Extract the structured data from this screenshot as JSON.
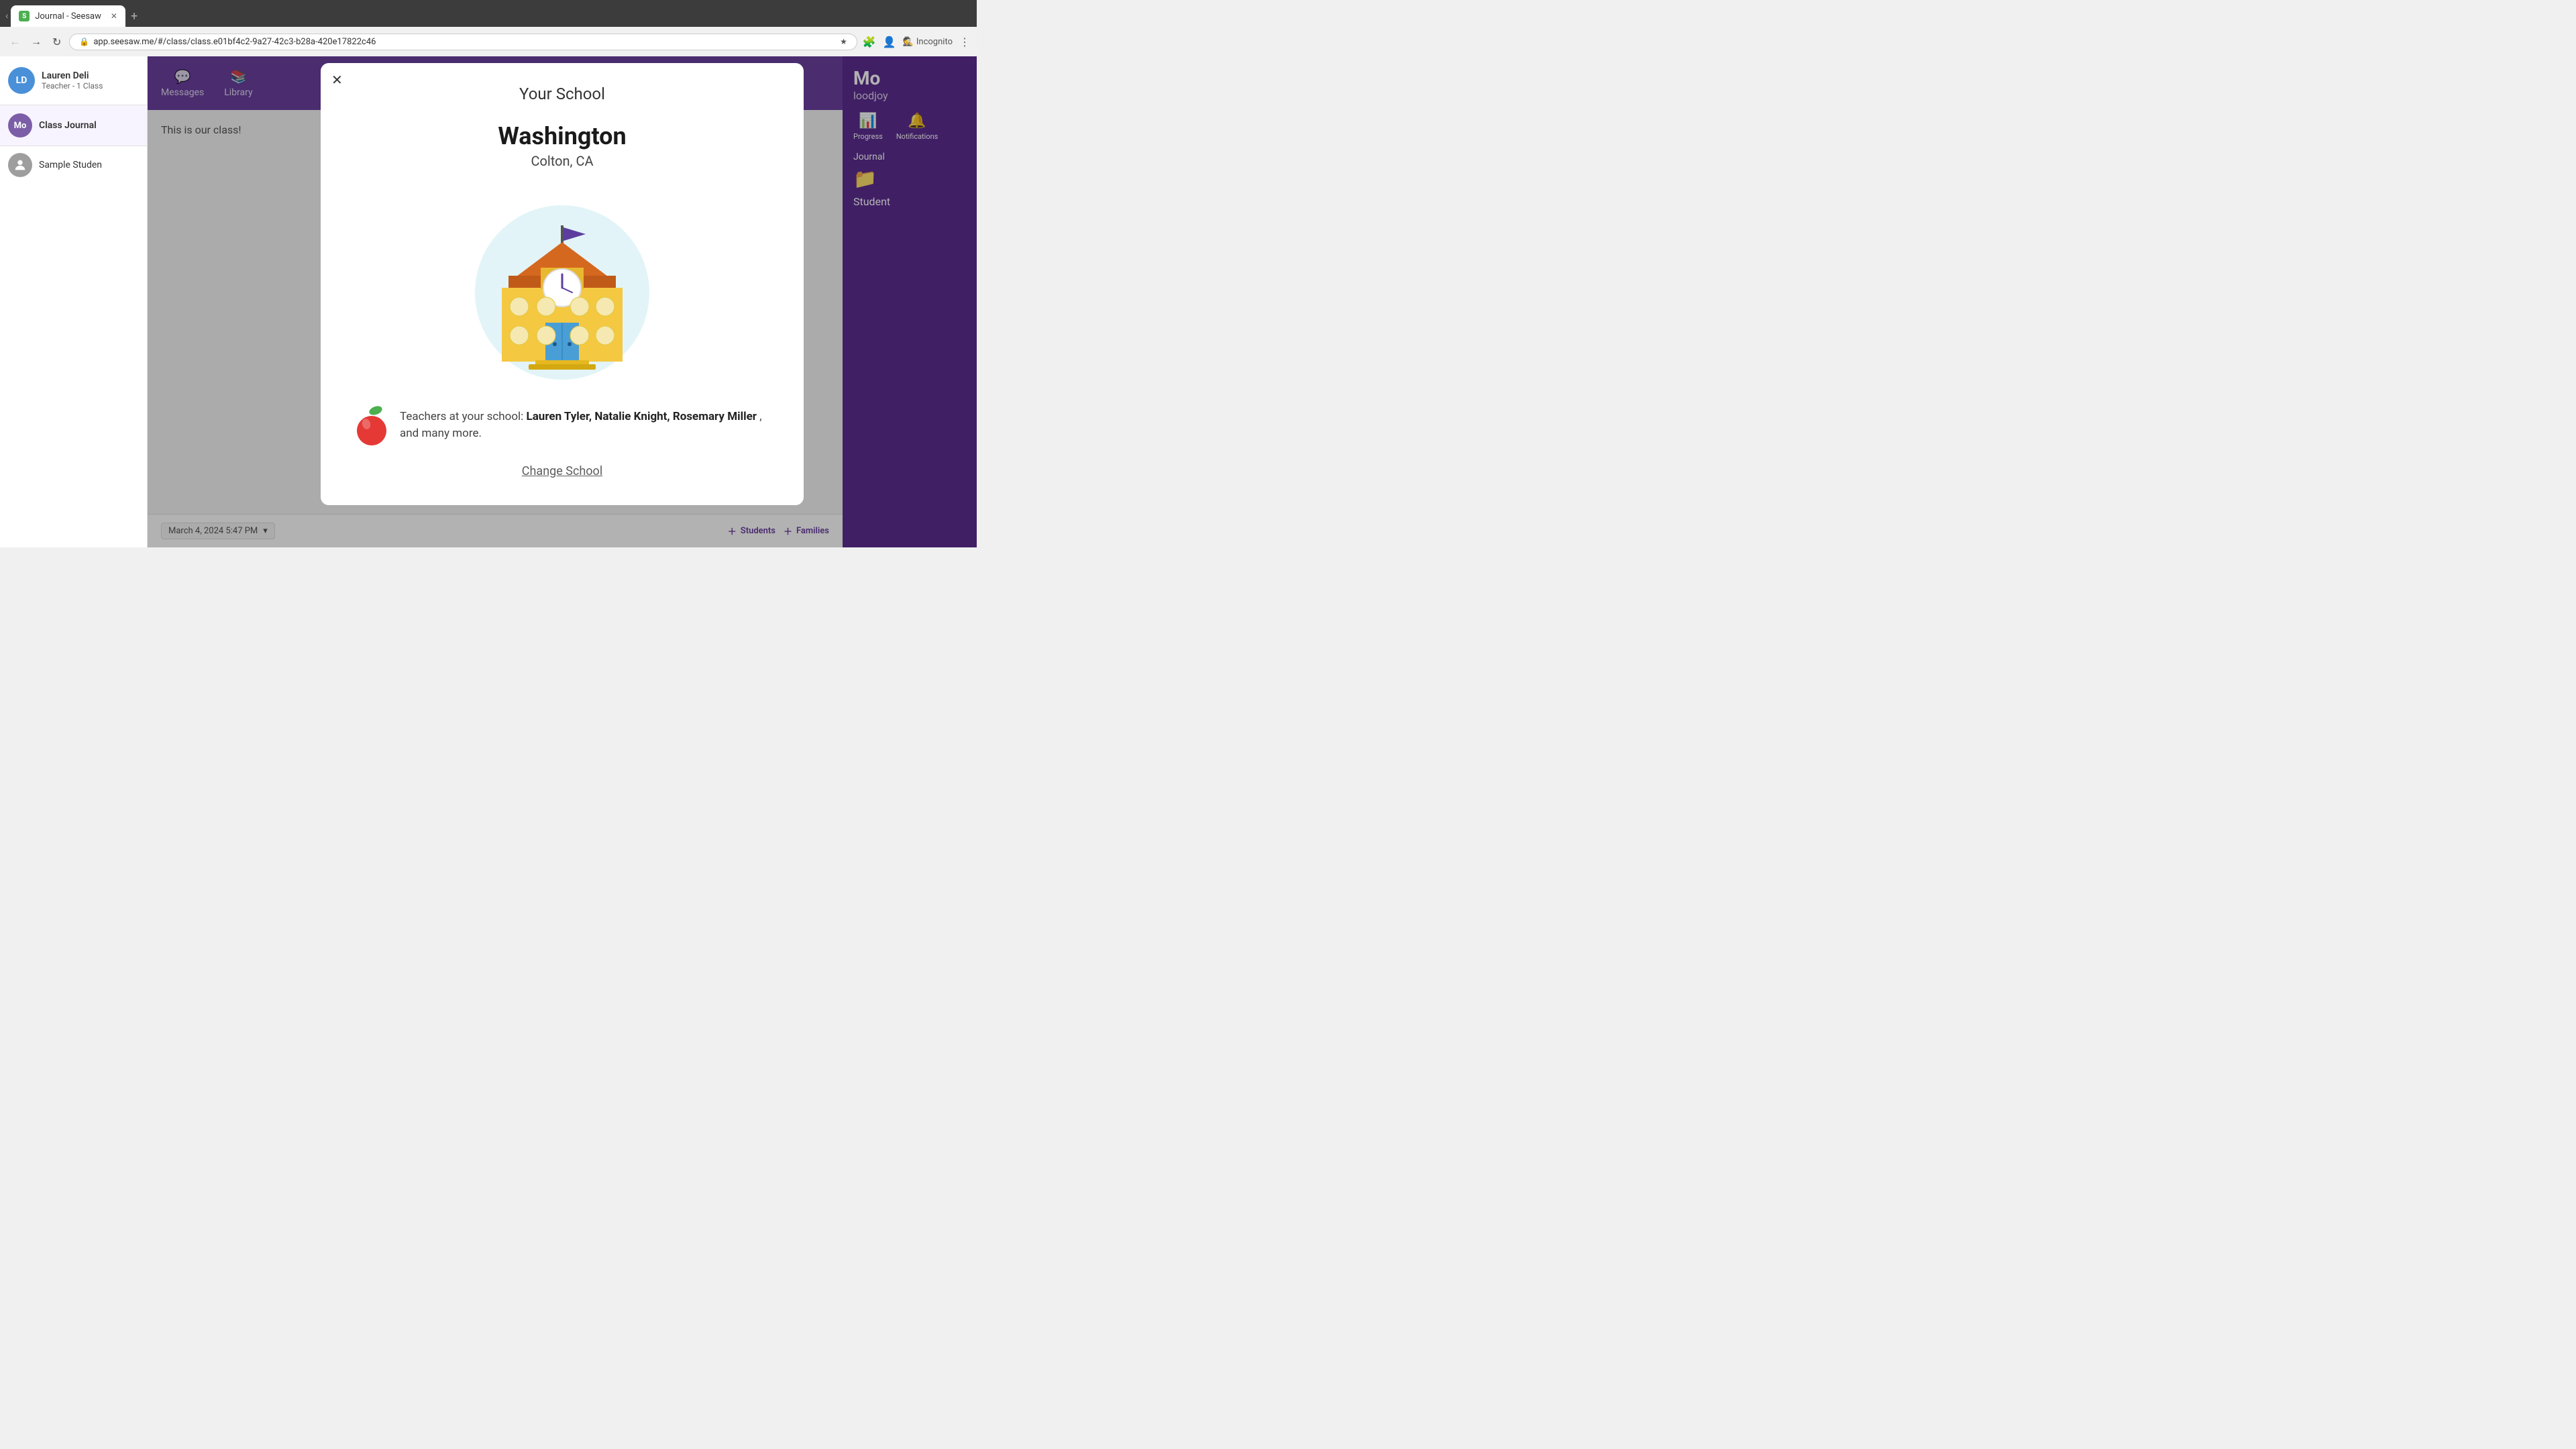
{
  "browser": {
    "tab_favicon": "S",
    "tab_title": "Journal - Seesaw",
    "address": "app.seesaw.me/#/class/class.e01bf4c2-9a27-42c3-b28a-420e17822c46",
    "incognito_label": "Incognito"
  },
  "sidebar": {
    "user": {
      "initials": "LD",
      "name": "Lauren Deli",
      "role": "Teacher - 1 Class"
    },
    "class": {
      "initials": "Mo",
      "name": "Class Journal"
    },
    "student": {
      "name": "Sample Studen"
    }
  },
  "header": {
    "nav_messages": "Messages",
    "nav_library": "Library"
  },
  "right_panel": {
    "name": "Mo",
    "username": "loodjoy",
    "nav_progress": "Progress",
    "nav_notifications": "Notifications",
    "journal_label": "Journal",
    "student_label": "Student"
  },
  "main": {
    "class_text": "This is our class!",
    "date": "March 4, 2024 5:47 PM",
    "students_btn": "Students",
    "families_btn": "Families"
  },
  "modal": {
    "title": "Your School",
    "school_name": "Washington",
    "school_location": "Colton, CA",
    "teachers_label": "Teachers at your school:",
    "teachers_list": "Lauren Tyler, Natalie Knight, Rosemary Miller",
    "teachers_more": ", and many more.",
    "change_school": "Change School"
  }
}
